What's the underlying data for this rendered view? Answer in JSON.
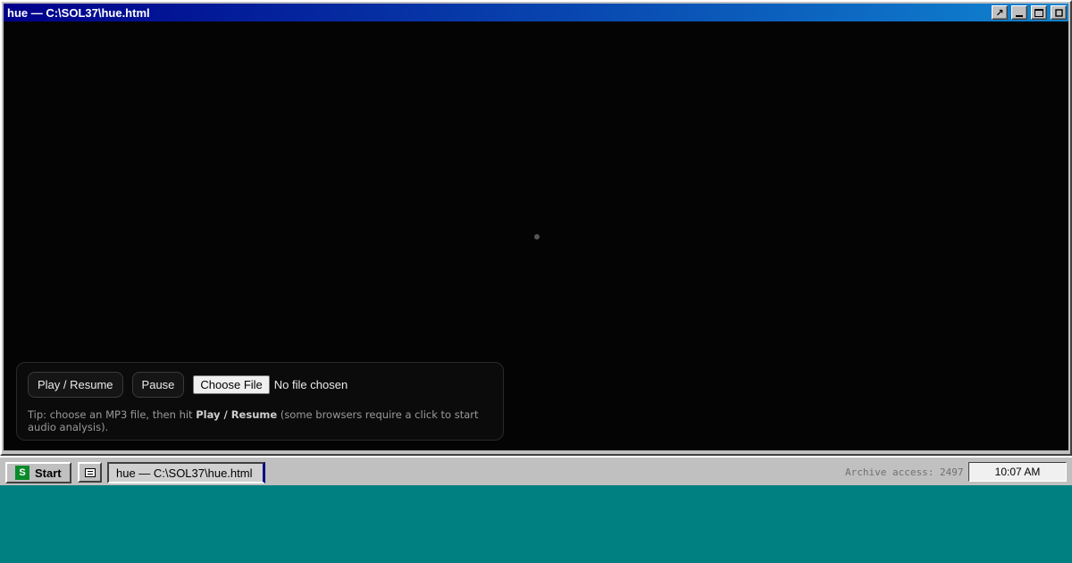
{
  "window": {
    "title": "hue — C:\\SOL37\\hue.html",
    "controls": {
      "help_glyph": "↗"
    }
  },
  "app": {
    "play_label": "Play / Resume",
    "pause_label": "Pause",
    "choose_file_label": "Choose File",
    "file_status": "No file chosen",
    "tip_prefix": "Tip: choose an MP3 file, then hit ",
    "tip_bold": "Play / Resume",
    "tip_suffix": " (some browsers require a click to start audio analysis)."
  },
  "taskbar": {
    "start_label": "Start",
    "start_logo_letter": "S",
    "task_label": "hue — C:\\SOL37\\hue.html",
    "archive_text": "Archive access: 2497",
    "clock": "10:07 AM"
  },
  "colors": {
    "desktop": "#008080",
    "titlebar_start": "#00008a",
    "titlebar_end": "#1084d0",
    "canvas_bg": "#040404"
  }
}
